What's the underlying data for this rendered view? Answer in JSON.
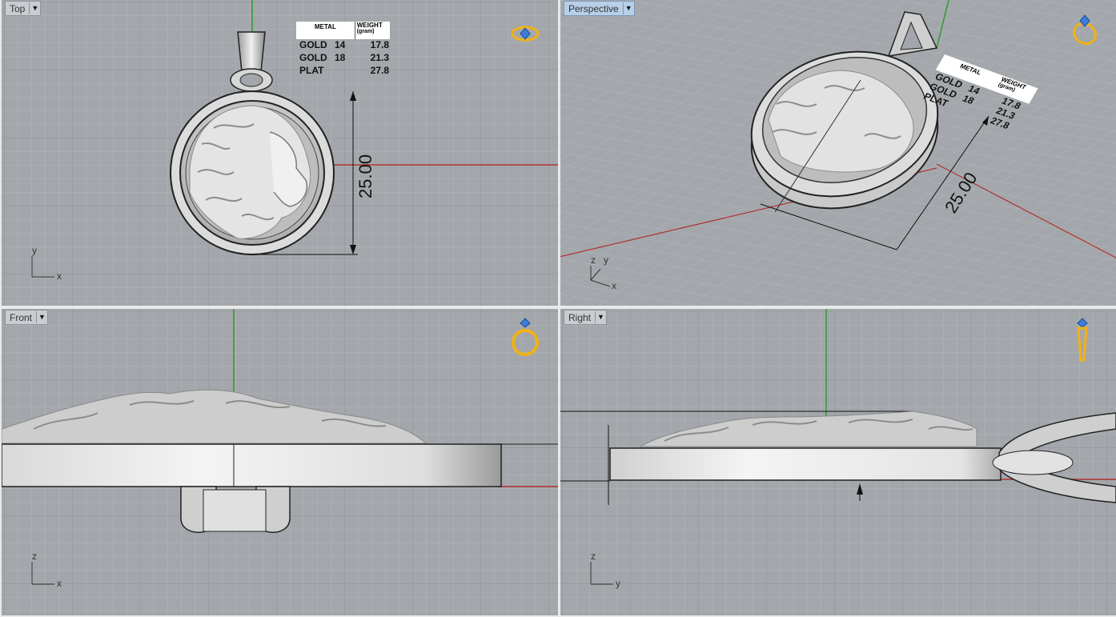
{
  "viewports": {
    "top": {
      "title": "Top",
      "axis_v": "y",
      "axis_h": "x",
      "dimension": "25.00"
    },
    "perspective": {
      "title": "Perspective",
      "axis_z": "z",
      "axis_y": "y",
      "axis_x": "x",
      "dimension": "25.00"
    },
    "front": {
      "title": "Front",
      "axis_v": "z",
      "axis_h": "x"
    },
    "right": {
      "title": "Right",
      "axis_v": "z",
      "axis_h": "y"
    }
  },
  "metal_table": {
    "header_metal": "METAL",
    "header_weight": "WEIGHT",
    "header_unit": "(gram)",
    "rows": [
      {
        "metal": "GOLD",
        "karat": "14",
        "weight": "17.8"
      },
      {
        "metal": "GOLD",
        "karat": "18",
        "weight": "21.3"
      },
      {
        "metal": "PLAT",
        "karat": "",
        "weight": "27.8"
      }
    ]
  },
  "icons": [
    "ring-top-view-icon",
    "ring-perspective-icon",
    "ring-front-icon",
    "ring-side-icon",
    "dropdown-arrow-icon"
  ],
  "colors": {
    "viewport_bg": "#a3a7ab",
    "grid_minor": "#b3b7bb",
    "grid_major": "#8f9397",
    "x_axis": "#b03030",
    "y_axis": "#2f9a2f",
    "active_title": "#b8cfe8",
    "ring_gold": "#f2b215",
    "gem_blue": "#3a7ed8"
  }
}
